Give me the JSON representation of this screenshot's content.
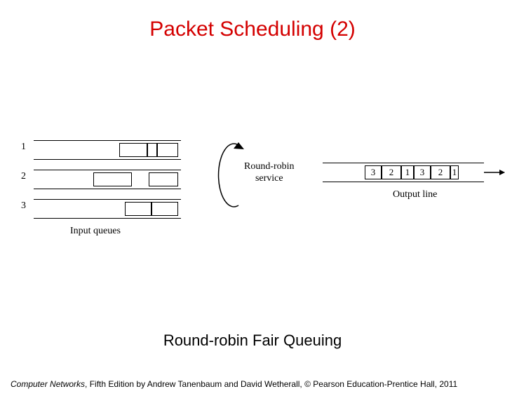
{
  "title": "Packet Scheduling (2)",
  "caption": "Round-robin Fair Queuing",
  "footer_book": "Computer Networks",
  "footer_rest": ", Fifth Edition by Andrew Tanenbaum and David Wetherall, © Pearson Education-Prentice Hall, 2011",
  "diagram": {
    "queues": [
      "1",
      "2",
      "3"
    ],
    "input_label": "Input queues",
    "rr_label_l1": "Round-robin",
    "rr_label_l2": "service",
    "output_cells": [
      "3",
      "2",
      "1",
      "3",
      "2",
      "1"
    ],
    "output_label": "Output line"
  }
}
